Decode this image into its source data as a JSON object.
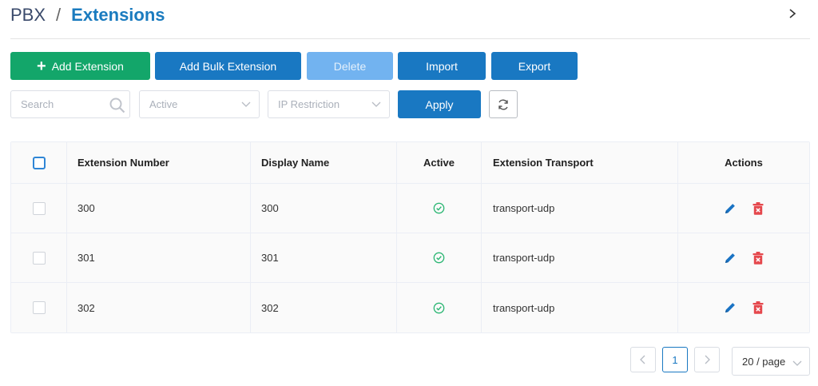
{
  "breadcrumb": {
    "root": "PBX",
    "separator": "/",
    "current": "Extensions"
  },
  "toolbar": {
    "add_extension_plus": "+",
    "add_extension": "Add Extension",
    "add_bulk_extension": "Add Bulk Extension",
    "delete": "Delete",
    "import": "Import",
    "export": "Export"
  },
  "filters": {
    "search_placeholder": "Search",
    "active_placeholder": "Active",
    "ip_restriction_placeholder": "IP Restriction",
    "apply": "Apply"
  },
  "table": {
    "columns": {
      "extension_number": "Extension Number",
      "display_name": "Display Name",
      "active": "Active",
      "extension_transport": "Extension Transport",
      "actions": "Actions"
    },
    "rows": [
      {
        "extension_number": "300",
        "display_name": "300",
        "active": true,
        "extension_transport": "transport-udp"
      },
      {
        "extension_number": "301",
        "display_name": "301",
        "active": true,
        "extension_transport": "transport-udp"
      },
      {
        "extension_number": "302",
        "display_name": "302",
        "active": true,
        "extension_transport": "transport-udp"
      }
    ]
  },
  "pagination": {
    "current_page": "1",
    "page_size": "20 / page"
  },
  "colors": {
    "primary": "#1978c2",
    "success": "#13a66a",
    "danger": "#e5484d",
    "active_check": "#2bb673"
  }
}
